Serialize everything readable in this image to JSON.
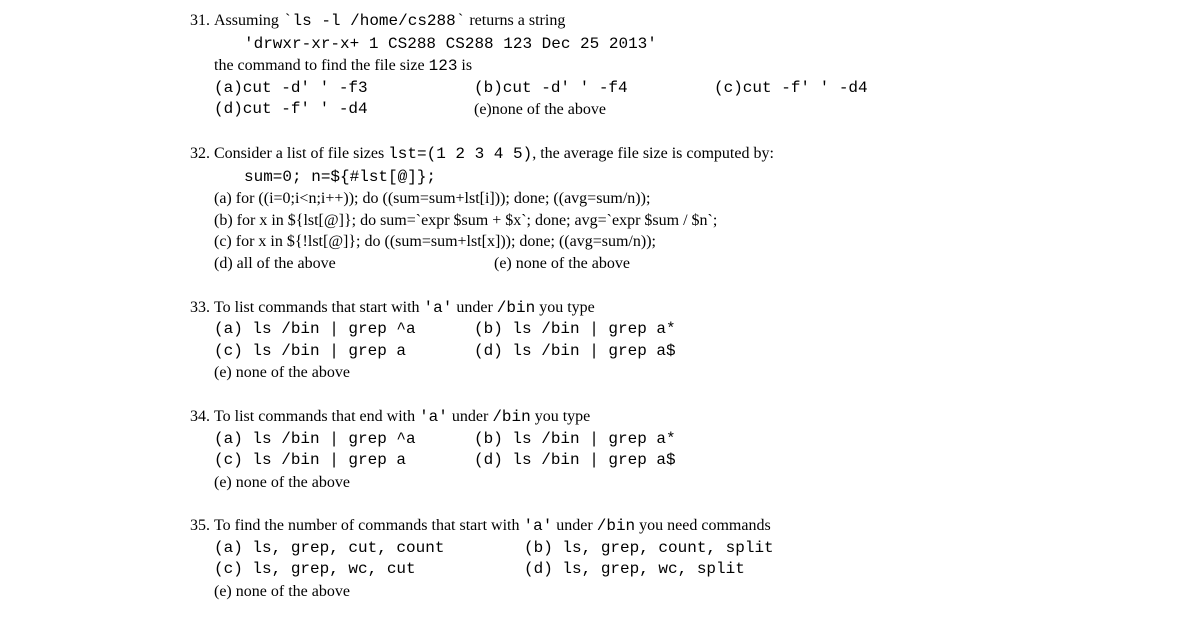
{
  "q31": {
    "num": "31.",
    "l1a": "Assuming  ",
    "l1b": "`ls -l /home/cs288`",
    "l1c": "  returns a string",
    "l2": "'drwxr-xr-x+ 1 CS288 CS288 123 Dec 25 2013'",
    "l3a": "the command to find the file size ",
    "l3b": "123",
    "l3c": " is",
    "a": "(a)cut -d' ' -f3",
    "b": "(b)cut -d' ' -f4",
    "c": "(c)cut -f' ' -d4",
    "d": "(d)cut -f' ' -d4",
    "e": "(e)none of the above"
  },
  "q32": {
    "num": "32.",
    "l1a": "Consider a list of file sizes ",
    "l1b": "lst=(1 2 3 4 5)",
    "l1c": ", the average file size is computed by:",
    "l2": "sum=0; n=${#lst[@]};",
    "a": "(a) for ((i=0;i<n;i++)); do ((sum=sum+lst[i])); done; ((avg=sum/n));",
    "b": "(b) for x in ${lst[@]}; do sum=`expr $sum + $x`; done; avg=`expr $sum / $n`;",
    "c": "(c) for x in ${!lst[@]}; do ((sum=sum+lst[x])); done; ((avg=sum/n));",
    "d": "(d) all of the above",
    "e": "(e) none of the above"
  },
  "q33": {
    "num": "33.",
    "l1a": "To list commands that start with ",
    "l1b": "'a'",
    "l1c": "  under ",
    "l1d": "/bin",
    "l1e": " you type",
    "a": "(a) ls /bin | grep ^a",
    "b": "(b) ls /bin | grep a*",
    "c": "(c) ls /bin | grep a",
    "d": "(d) ls /bin | grep a$",
    "e": "(e) none of the above"
  },
  "q34": {
    "num": "34.",
    "l1a": "To list commands that end with ",
    "l1b": "'a'",
    "l1c": "  under ",
    "l1d": "/bin",
    "l1e": " you type",
    "a": "(a) ls /bin | grep ^a",
    "b": "(b) ls /bin | grep a*",
    "c": "(c) ls /bin | grep a",
    "d": "(d) ls /bin | grep a$",
    "e": "(e) none of the above"
  },
  "q35": {
    "num": "35.",
    "l1a": "To find the number of commands that start with ",
    "l1b": "'a'",
    "l1c": "  under ",
    "l1d": "/bin",
    "l1e": "  you need commands",
    "a": "(a) ls, grep, cut, count",
    "b": "(b) ls, grep, count, split",
    "c": "(c) ls, grep, wc, cut",
    "d": "(d) ls, grep, wc, split",
    "e": "(e) none of the above"
  }
}
